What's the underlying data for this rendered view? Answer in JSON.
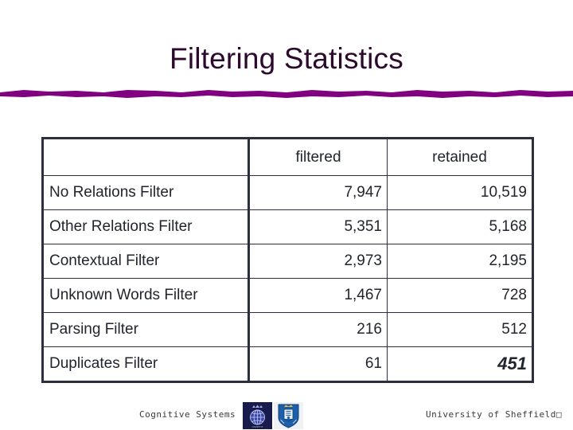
{
  "slide": {
    "title": "Filtering Statistics",
    "title_color": "#2d0a2d",
    "rule_color": "#800080",
    "border_color": "#2b2f3e"
  },
  "table": {
    "columns": [
      "",
      "filtered",
      "retained"
    ],
    "rows": [
      {
        "label": "No Relations Filter",
        "filtered": "7,947",
        "retained": "10,519",
        "retained_emphasis": false
      },
      {
        "label": "Other Relations Filter",
        "filtered": "5,351",
        "retained": "5,168",
        "retained_emphasis": false
      },
      {
        "label": "Contextual Filter",
        "filtered": "2,973",
        "retained": "2,195",
        "retained_emphasis": false
      },
      {
        "label": "Unknown Words Filter",
        "filtered": "1,467",
        "retained": "728",
        "retained_emphasis": false
      },
      {
        "label": "Parsing Filter",
        "filtered": "216",
        "retained": "512",
        "retained_emphasis": false
      },
      {
        "label": "Duplicates Filter",
        "filtered": "61",
        "retained": "451",
        "retained_emphasis": true
      }
    ]
  },
  "footer": {
    "left_text": "Cognitive Systems",
    "right_text": "University of Sheffield□",
    "logos": [
      {
        "name": "cognitive-systems-crest-logo"
      },
      {
        "name": "university-of-sheffield-shield-logo"
      }
    ]
  }
}
